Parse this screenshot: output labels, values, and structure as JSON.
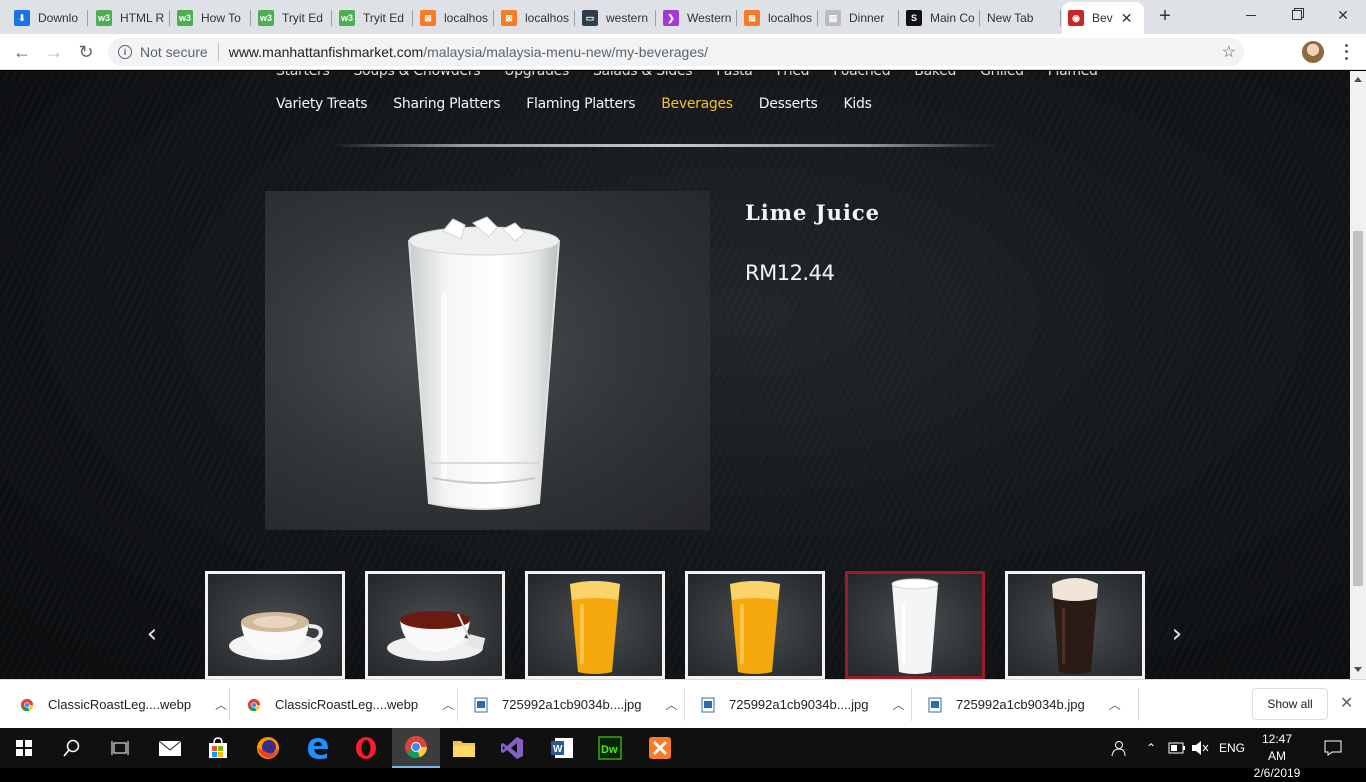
{
  "browser": {
    "tabs": [
      {
        "label": "Downlo",
        "icon": "download-icon"
      },
      {
        "label": "HTML R",
        "icon": "w3schools-icon"
      },
      {
        "label": "How To",
        "icon": "w3schools-icon"
      },
      {
        "label": "Tryit Ed",
        "icon": "w3schools-icon"
      },
      {
        "label": "Tryit Ed",
        "icon": "w3schools-icon"
      },
      {
        "label": "localhos",
        "icon": "xampp-icon"
      },
      {
        "label": "localhos",
        "icon": "xampp-icon"
      },
      {
        "label": "western",
        "icon": "site-icon"
      },
      {
        "label": "Western",
        "icon": "arrow-site-icon"
      },
      {
        "label": "localhos",
        "icon": "xampp-icon"
      },
      {
        "label": "Dinner",
        "icon": "page-icon"
      },
      {
        "label": "Main Co",
        "icon": "s-icon"
      },
      {
        "label": "New Tab",
        "icon": ""
      },
      {
        "label": "Bev",
        "icon": "manhattan-fish-icon"
      }
    ],
    "url_security": "Not secure",
    "url_host": "www.manhattanfishmarket.com",
    "url_path": "/malaysia/malaysia-menu-new/my-beverages/"
  },
  "menu": {
    "row1": [
      "Starters",
      "Soups & Chowders",
      "Upgrades",
      "Salads & Sides",
      "Pasta",
      "Fried",
      "Poached",
      "Baked",
      "Grilled",
      "Flamed"
    ],
    "row2": [
      "Variety Treats",
      "Sharing Platters",
      "Flaming Platters",
      "Beverages",
      "Desserts",
      "Kids"
    ],
    "active": "Beverages"
  },
  "product": {
    "name": "Lime Juice",
    "price": "RM12.44"
  },
  "carousel": {
    "prev_glyph": "‹",
    "next_glyph": "›",
    "thumbnails": [
      {
        "name": "cappuccino-thumbnail",
        "kind": "coffee"
      },
      {
        "name": "tea-thumbnail",
        "kind": "tea"
      },
      {
        "name": "orange-juice-thumbnail",
        "kind": "orange"
      },
      {
        "name": "orange-juice-2-thumbnail",
        "kind": "orange"
      },
      {
        "name": "lime-juice-thumbnail",
        "kind": "lime",
        "selected": true
      },
      {
        "name": "root-beer-float-thumbnail",
        "kind": "rootbeer"
      }
    ]
  },
  "downloads": {
    "items": [
      {
        "label": "ClassicRoastLeg....webp",
        "icon": "chrome-icon"
      },
      {
        "label": "ClassicRoastLeg....webp",
        "icon": "chrome-icon"
      },
      {
        "label": "725992a1cb9034b....jpg",
        "icon": "image-file-icon"
      },
      {
        "label": "725992a1cb9034b....jpg",
        "icon": "image-file-icon"
      },
      {
        "label": "725992a1cb9034b.jpg",
        "icon": "image-file-icon"
      }
    ],
    "show_all": "Show all"
  },
  "taskbar": {
    "lang": "ENG",
    "time": "12:47 AM",
    "date": "2/6/2019"
  },
  "colors": {
    "active_menu": "#f6c026",
    "selected_thumb_border": "#9b1b2b"
  }
}
